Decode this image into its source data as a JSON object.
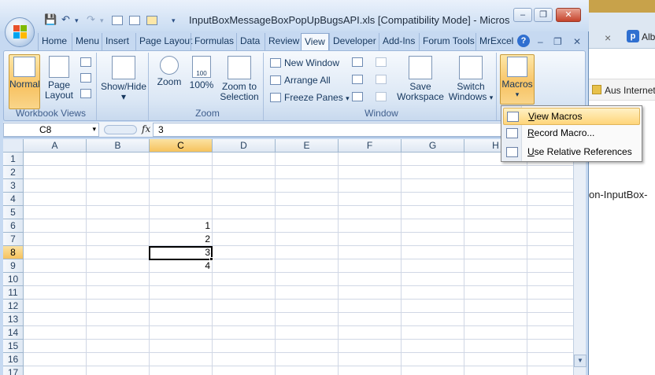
{
  "background_window": {
    "tab_close": "×",
    "tab_icon_letter": "p",
    "tab_text": "Alb",
    "favorites_text": "Aus Internet",
    "body_text": "on-InputBox-"
  },
  "titlebar": {
    "title": "InputBoxMessageBoxPopUpBugsAPI.xls  [Compatibility Mode] - Micros",
    "qat": {
      "save": "💾",
      "undo": "↶",
      "undo_dd": "▾",
      "redo": "↷",
      "redo_dd": "▾",
      "custom_dd": "▾"
    },
    "minimize": "–",
    "restore": "❐",
    "close": "✕"
  },
  "tabs": [
    "Home",
    "Menu",
    "Insert",
    "Page Layout",
    "Formulas",
    "Data",
    "Review",
    "View",
    "Developer",
    "Add-Ins",
    "Forum Tools",
    "MrExcel"
  ],
  "active_tab": "View",
  "ribbon_right": {
    "help": "?",
    "minimize": "–",
    "restore": "❐",
    "close": "✕"
  },
  "ribbon": {
    "workbook_views": {
      "label": "Workbook Views",
      "normal": "Normal",
      "page_layout_1": "Page",
      "page_layout_2": "Layout"
    },
    "show_hide": {
      "label": "Show/Hide",
      "dd": "▾"
    },
    "zoom": {
      "label": "Zoom",
      "zoom": "Zoom",
      "hundred": "100%",
      "hundred_icon_text": "100",
      "zoom_sel_1": "Zoom to",
      "zoom_sel_2": "Selection"
    },
    "window": {
      "label": "Window",
      "new_window": "New Window",
      "arrange_all": "Arrange All",
      "freeze_panes": "Freeze Panes",
      "freeze_dd": "▾",
      "save_ws_1": "Save",
      "save_ws_2": "Workspace",
      "switch_1": "Switch",
      "switch_2": "Windows",
      "switch_dd": "▾"
    },
    "macros": {
      "label": "Macros",
      "dd": "▾"
    }
  },
  "formula_bar": {
    "name_box": "C8",
    "name_dd": "▾",
    "fx": "fx",
    "formula": "3"
  },
  "grid": {
    "columns": [
      "A",
      "B",
      "C",
      "D",
      "E",
      "F",
      "G",
      "H"
    ],
    "rows": [
      "1",
      "2",
      "3",
      "4",
      "5",
      "6",
      "7",
      "8",
      "9",
      "10",
      "11",
      "12",
      "13",
      "14",
      "15",
      "16",
      "17"
    ],
    "selected_column": "C",
    "selected_row": "8",
    "cells": [
      {
        "ref": "C6",
        "value": "1"
      },
      {
        "ref": "C7",
        "value": "2"
      },
      {
        "ref": "C8",
        "value": "3"
      },
      {
        "ref": "C9",
        "value": "4"
      }
    ]
  },
  "scrollbar": {
    "up": "▲",
    "down": "▼"
  },
  "macros_menu": [
    {
      "ul": "V",
      "rest": "iew Macros",
      "highlighted": true
    },
    {
      "ul": "R",
      "rest": "ecord Macro...",
      "highlighted": false
    },
    {
      "ul": "U",
      "rest": "se Relative References",
      "highlighted": false
    }
  ]
}
